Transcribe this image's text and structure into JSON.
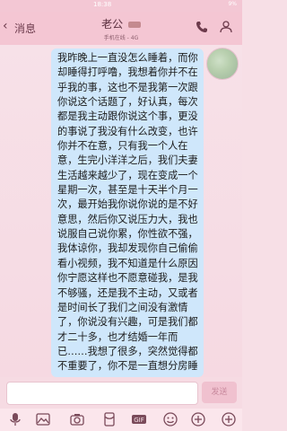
{
  "status": {
    "time": "18:38",
    "right": "9%"
  },
  "header": {
    "back_label": "消息",
    "contact_name": "老公",
    "subtitle": "手机在线 - 4G"
  },
  "message": {
    "text": "我昨晚上一直没怎么睡着，而你却睡得打呼噜，我想着你并不在乎我的事，这也不是我第一次跟你说这个话题了，好认真，每次都是我主动跟你说这个事，更没的事说了我没有什么改变，也许你并不在意，只有我一个人在意，生完小洋洋之后，我们夫妻生活越来越少了，现在变成一个星期一次，甚至是十天半个月一次，最开始我你说你说的是不好意思，然后你又说压力大，我也说服自己说你累，你性欲不强，我体谅你，我却发现你自己偷偷看小视频，我不知道是什么原因你宁愿这样也不愿意碰我，是我不够骚，还是我不主动，又或者是时间长了我们之间没有激情了，你说没有兴趣，可是我们都才二十多，也才结婚一年而已……我想了很多，突然觉得都不重要了，你不是一直想分房睡吗？以后你可"
  },
  "input": {
    "placeholder": "",
    "send_label": "发送"
  }
}
